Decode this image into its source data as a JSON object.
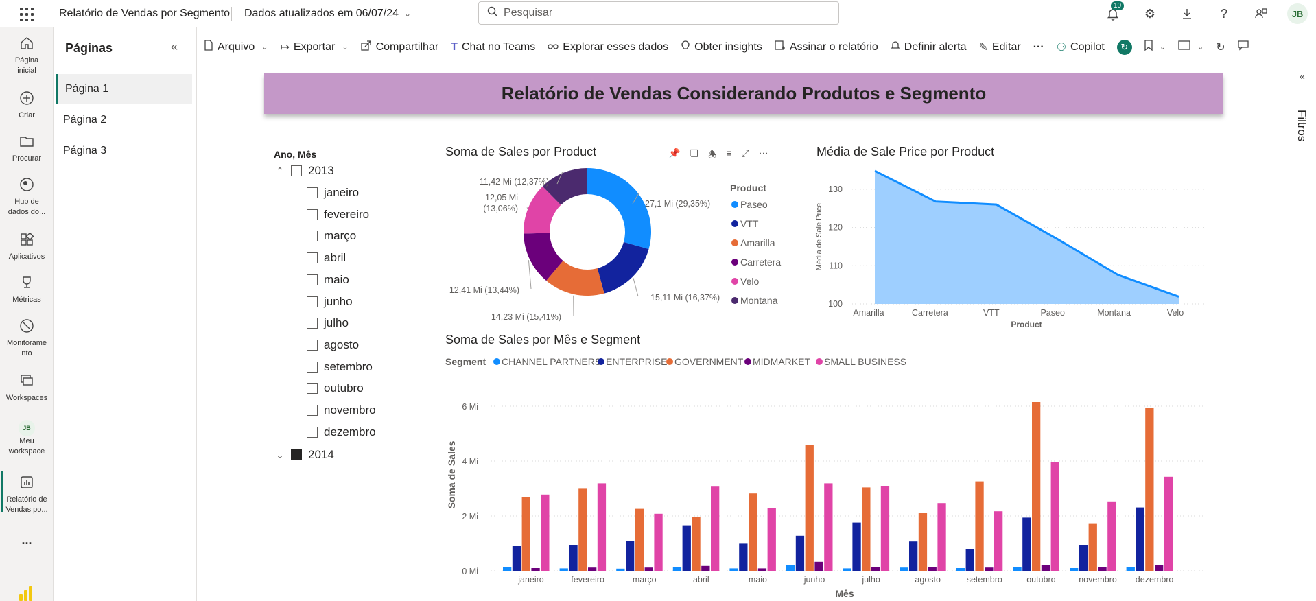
{
  "topbar": {
    "report_title": "Relatório de Vendas por Segmento",
    "data_updated": "Dados atualizados em 06/07/24",
    "search_placeholder": "Pesquisar",
    "notification_count": "10",
    "user_initials": "JB"
  },
  "leftnav": {
    "items": [
      {
        "label1": "Página",
        "label2": "inicial",
        "icon": "home-icon"
      },
      {
        "label1": "Criar",
        "label2": "",
        "icon": "create-icon"
      },
      {
        "label1": "Procurar",
        "label2": "",
        "icon": "browse-icon"
      },
      {
        "label1": "Hub de",
        "label2": "dados do...",
        "icon": "data-hub-icon"
      },
      {
        "label1": "Aplicativos",
        "label2": "",
        "icon": "apps-icon"
      },
      {
        "label1": "Métricas",
        "label2": "",
        "icon": "metrics-icon"
      },
      {
        "label1": "Monitorame",
        "label2": "nto",
        "icon": "monitor-icon"
      },
      {
        "label1": "Workspaces",
        "label2": "",
        "icon": "workspaces-icon"
      },
      {
        "label1": "Meu",
        "label2": "workspace",
        "icon": "my-workspace-icon"
      },
      {
        "label1": "Relatório de",
        "label2": "Vendas po...",
        "icon": "report-icon"
      }
    ],
    "workspace_initials": "JB",
    "more": "..."
  },
  "pages": {
    "title": "Páginas",
    "items": [
      "Página 1",
      "Página 2",
      "Página 3"
    ]
  },
  "toolbar": {
    "arquivo": "Arquivo",
    "exportar": "Exportar",
    "compartilhar": "Compartilhar",
    "teams": "Chat no Teams",
    "explorar": "Explorar esses dados",
    "insights": "Obter insights",
    "assinar": "Assinar o relatório",
    "alerta": "Definir alerta",
    "editar": "Editar",
    "more": "···",
    "copilot": "Copilot"
  },
  "filters": {
    "label": "Filtros"
  },
  "banner": {
    "title": "Relatório de Vendas Considerando Produtos e Segmento"
  },
  "slicer": {
    "title": "Ano, Mês",
    "years": [
      {
        "label": "2013",
        "months": [
          "janeiro",
          "fevereiro",
          "março",
          "abril",
          "maio",
          "junho",
          "julho",
          "agosto",
          "setembro",
          "outubro",
          "novembro",
          "dezembro"
        ]
      },
      {
        "label": "2014"
      }
    ]
  },
  "colors": {
    "channel_partners": "#118DFF",
    "enterprise": "#12239E",
    "government": "#E66C37",
    "midmarket": "#6B007B",
    "small_business": "#E044A7",
    "montana": "#4B2A6E",
    "area_fill": "#9ECFFF",
    "area_line": "#118DFF"
  },
  "chart_data": [
    {
      "type": "pie",
      "title": "Soma de Sales por Product",
      "legend_title": "Product",
      "legend_position": "right",
      "categories": [
        "Paseo",
        "VTT",
        "Amarilla",
        "Carretera",
        "Velo",
        "Montana"
      ],
      "values": [
        27.1,
        15.11,
        14.23,
        12.41,
        12.05,
        11.42
      ],
      "data_labels": [
        "27,1 Mi (29,35%)",
        "15,11 Mi (16,37%)",
        "14,23 Mi (15,41%)",
        "12,41 Mi (13,44%)",
        "12,05 Mi (13,06%)",
        "11,42 Mi (12,37%)"
      ],
      "colors": [
        "#118DFF",
        "#12239E",
        "#E66C37",
        "#6B007B",
        "#E044A7",
        "#4B2A6E"
      ]
    },
    {
      "type": "area",
      "title": "Média de Sale Price por Product",
      "xlabel": "Product",
      "ylabel": "Média de Sale Price",
      "categories": [
        "Amarilla",
        "Carretera",
        "VTT",
        "Paseo",
        "Montana",
        "Velo"
      ],
      "values": [
        134.8,
        126.8,
        126.0,
        117.0,
        107.6,
        101.9
      ],
      "ylim": [
        100,
        135
      ],
      "yticks": [
        100,
        110,
        120,
        130
      ],
      "grid": true
    },
    {
      "type": "bar",
      "title": "Soma de Sales por Mês e Segment",
      "xlabel": "Mês",
      "ylabel": "Soma de Sales",
      "legend_title": "Segment",
      "legend_position": "top-left",
      "categories": [
        "janeiro",
        "fevereiro",
        "março",
        "abril",
        "maio",
        "junho",
        "julho",
        "agosto",
        "setembro",
        "outubro",
        "novembro",
        "dezembro"
      ],
      "ytick_labels": [
        "0 Mi",
        "2 Mi",
        "4 Mi",
        "6 Mi"
      ],
      "yticks": [
        0,
        2,
        4,
        6
      ],
      "ylim": [
        0,
        6.6
      ],
      "grid": true,
      "series": [
        {
          "name": "CHANNEL PARTNERS",
          "values": [
            0.13,
            0.09,
            0.08,
            0.14,
            0.09,
            0.2,
            0.09,
            0.12,
            0.1,
            0.15,
            0.1,
            0.14
          ]
        },
        {
          "name": "ENTERPRISE",
          "values": [
            0.9,
            0.93,
            1.08,
            1.66,
            0.99,
            1.28,
            1.76,
            1.07,
            0.8,
            1.94,
            0.93,
            2.31
          ]
        },
        {
          "name": "GOVERNMENT",
          "values": [
            2.7,
            2.99,
            2.26,
            1.96,
            2.82,
            4.6,
            3.04,
            2.1,
            3.26,
            6.15,
            1.71,
            5.93
          ]
        },
        {
          "name": "MIDMARKET",
          "values": [
            0.1,
            0.12,
            0.12,
            0.18,
            0.09,
            0.33,
            0.14,
            0.13,
            0.12,
            0.22,
            0.13,
            0.21
          ]
        },
        {
          "name": "SMALL BUSINESS",
          "values": [
            2.78,
            3.19,
            2.08,
            3.07,
            2.28,
            3.19,
            3.1,
            2.47,
            2.17,
            3.97,
            2.53,
            3.43
          ]
        }
      ],
      "colors": [
        "#118DFF",
        "#12239E",
        "#E66C37",
        "#6B007B",
        "#E044A7"
      ]
    }
  ]
}
